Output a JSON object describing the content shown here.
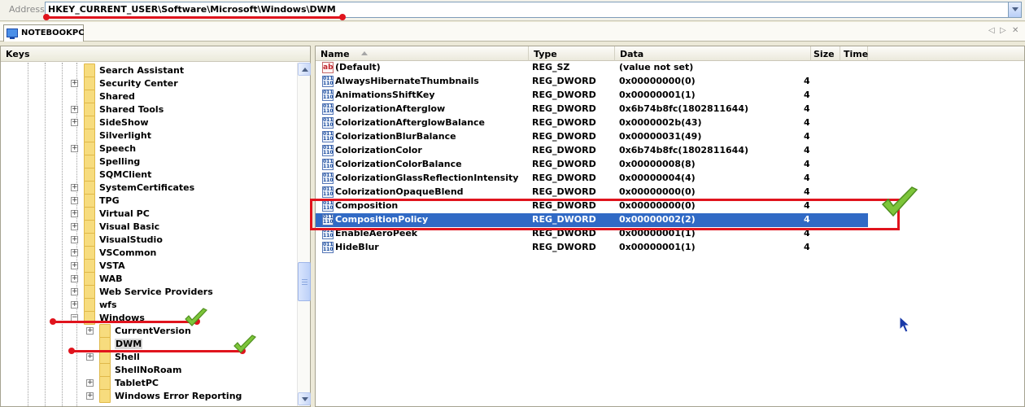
{
  "address": {
    "label": "Address",
    "value": "HKEY_CURRENT_USER\\Software\\Microsoft\\Windows\\DWM"
  },
  "tab": {
    "label": "NOTEBOOKPC"
  },
  "keys_pane": {
    "title": "Keys",
    "items": [
      {
        "label": "Search Assistant",
        "level": 1,
        "expandable": false
      },
      {
        "label": "Security Center",
        "level": 1,
        "expandable": true
      },
      {
        "label": "Shared",
        "level": 1,
        "expandable": false
      },
      {
        "label": "Shared Tools",
        "level": 1,
        "expandable": true
      },
      {
        "label": "SideShow",
        "level": 1,
        "expandable": true
      },
      {
        "label": "Silverlight",
        "level": 1,
        "expandable": false
      },
      {
        "label": "Speech",
        "level": 1,
        "expandable": true
      },
      {
        "label": "Spelling",
        "level": 1,
        "expandable": false
      },
      {
        "label": "SQMClient",
        "level": 1,
        "expandable": false
      },
      {
        "label": "SystemCertificates",
        "level": 1,
        "expandable": true
      },
      {
        "label": "TPG",
        "level": 1,
        "expandable": true
      },
      {
        "label": "Virtual PC",
        "level": 1,
        "expandable": true
      },
      {
        "label": "Visual Basic",
        "level": 1,
        "expandable": true
      },
      {
        "label": "VisualStudio",
        "level": 1,
        "expandable": true
      },
      {
        "label": "VSCommon",
        "level": 1,
        "expandable": true
      },
      {
        "label": "VSTA",
        "level": 1,
        "expandable": true
      },
      {
        "label": "WAB",
        "level": 1,
        "expandable": true
      },
      {
        "label": "Web Service Providers",
        "level": 1,
        "expandable": true
      },
      {
        "label": "wfs",
        "level": 1,
        "expandable": true
      },
      {
        "label": "Windows",
        "level": 1,
        "expandable": true,
        "expanded": true
      },
      {
        "label": "CurrentVersion",
        "level": 2,
        "expandable": true
      },
      {
        "label": "DWM",
        "level": 2,
        "expandable": false,
        "selected": true
      },
      {
        "label": "Shell",
        "level": 2,
        "expandable": true
      },
      {
        "label": "ShellNoRoam",
        "level": 2,
        "expandable": false
      },
      {
        "label": "TabletPC",
        "level": 2,
        "expandable": true
      },
      {
        "label": "Windows Error Reporting",
        "level": 2,
        "expandable": true
      }
    ]
  },
  "values_pane": {
    "columns": [
      "Name",
      "Type",
      "Data",
      "Size",
      "Time"
    ],
    "rows": [
      {
        "name": "(Default)",
        "type": "REG_SZ",
        "data": "(value not set)",
        "size": "",
        "icon": "string-value-icon"
      },
      {
        "name": "AlwaysHibernateThumbnails",
        "type": "REG_DWORD",
        "data": "0x00000000(0)",
        "size": "4",
        "icon": "binary-value-icon"
      },
      {
        "name": "AnimationsShiftKey",
        "type": "REG_DWORD",
        "data": "0x00000001(1)",
        "size": "4",
        "icon": "binary-value-icon"
      },
      {
        "name": "ColorizationAfterglow",
        "type": "REG_DWORD",
        "data": "0x6b74b8fc(1802811644)",
        "size": "4",
        "icon": "binary-value-icon"
      },
      {
        "name": "ColorizationAfterglowBalance",
        "type": "REG_DWORD",
        "data": "0x0000002b(43)",
        "size": "4",
        "icon": "binary-value-icon"
      },
      {
        "name": "ColorizationBlurBalance",
        "type": "REG_DWORD",
        "data": "0x00000031(49)",
        "size": "4",
        "icon": "binary-value-icon"
      },
      {
        "name": "ColorizationColor",
        "type": "REG_DWORD",
        "data": "0x6b74b8fc(1802811644)",
        "size": "4",
        "icon": "binary-value-icon"
      },
      {
        "name": "ColorizationColorBalance",
        "type": "REG_DWORD",
        "data": "0x00000008(8)",
        "size": "4",
        "icon": "binary-value-icon"
      },
      {
        "name": "ColorizationGlassReflectionIntensity",
        "type": "REG_DWORD",
        "data": "0x00000004(4)",
        "size": "4",
        "icon": "binary-value-icon"
      },
      {
        "name": "ColorizationOpaqueBlend",
        "type": "REG_DWORD",
        "data": "0x00000000(0)",
        "size": "4",
        "icon": "binary-value-icon"
      },
      {
        "name": "Composition",
        "type": "REG_DWORD",
        "data": "0x00000000(0)",
        "size": "4",
        "icon": "binary-value-icon"
      },
      {
        "name": "CompositionPolicy",
        "type": "REG_DWORD",
        "data": "0x00000002(2)",
        "size": "4",
        "icon": "binary-value-icon",
        "selected": true
      },
      {
        "name": "EnableAeroPeek",
        "type": "REG_DWORD",
        "data": "0x00000001(1)",
        "size": "4",
        "icon": "binary-value-icon"
      },
      {
        "name": "HideBlur",
        "type": "REG_DWORD",
        "data": "0x00000001(1)",
        "size": "4",
        "icon": "binary-value-icon"
      }
    ]
  },
  "colors": {
    "selection": "#316ac5",
    "annotation_red": "#e0141d",
    "annotation_check": "#7dc53a"
  }
}
